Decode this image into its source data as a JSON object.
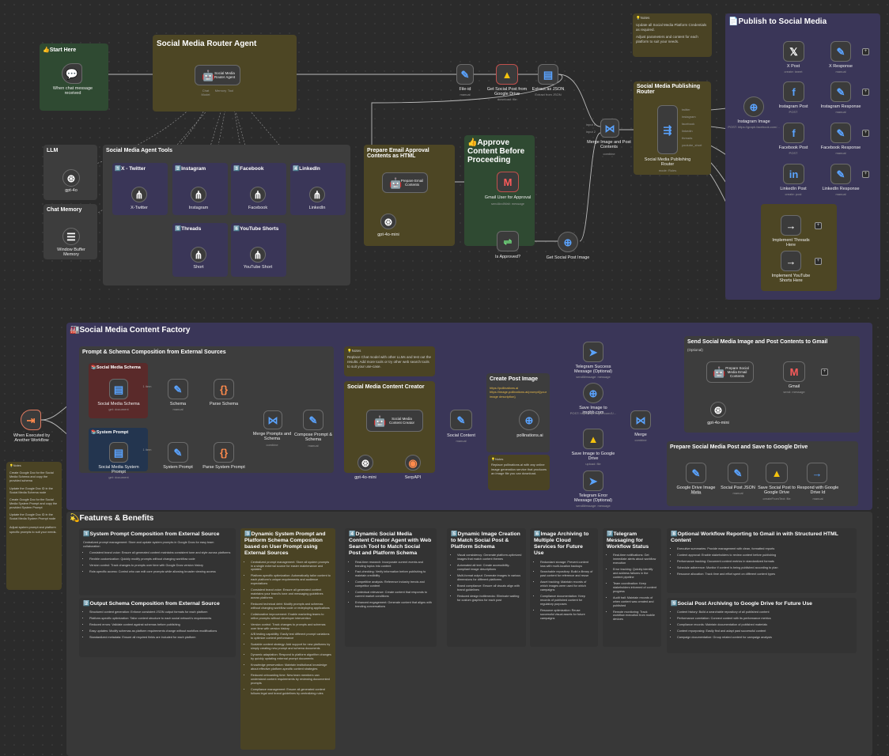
{
  "top": {
    "start_title": "👍Start Here",
    "router_title": "Social Media Router Agent",
    "router_node": {
      "label": "Social Media Router Agent",
      "sub": "Tools Agent"
    },
    "trigger_node": {
      "label": "When chat message received"
    },
    "port_labels": [
      "Chat Model",
      "Memory",
      "Tool"
    ],
    "llm_title": "LLM",
    "llm_node": "gpt-4o",
    "memory_title": "Chat Memory",
    "memory_node": "Window Buffer Memory",
    "tools_title": "Social Media Agent Tools",
    "tools": [
      {
        "title": "1️⃣X - Twitter",
        "node": "X-Twitter"
      },
      {
        "title": "2️⃣Instagram",
        "node": "Instagram"
      },
      {
        "title": "3️⃣Facebook",
        "node": "Facebook"
      },
      {
        "title": "4️⃣LinkedIn",
        "node": "LinkedIn"
      },
      {
        "title": "5️⃣Threads",
        "node": "Short"
      },
      {
        "title": "6️⃣YouTube Shorts",
        "node": "YouTube Short"
      }
    ],
    "file_id": {
      "label": "File-id",
      "sub": "manual"
    },
    "gdrive_get": {
      "label": "Get Social Post from Google Drive",
      "sub": "download: file"
    },
    "extract_json": {
      "label": "Extract as JSON",
      "sub": "Extract from JSON"
    },
    "email_title": "Prepare Email Approval Contents as HTML",
    "email_node": {
      "label": "Prepare Email Contents",
      "sub": "Tools Agent"
    },
    "email_model": "gpt-4o-mini",
    "approve_title": "👍Approve Content Before Proceeding",
    "gmail_node": {
      "label": "Gmail User for Approval",
      "sub": "sendAndWait: message"
    },
    "is_approved": "Is Approved?",
    "get_image": "Get Social Post Image",
    "merge_node": {
      "label": "Merge Image and Post Contents",
      "sub": "combine"
    },
    "merge_ports": [
      "input 1",
      "input 2"
    ],
    "notes_text": [
      "💡Notes",
      "Update all Social Media Platform Credentials as required.",
      "Adjust parameters and content for each platform to suit your needs."
    ],
    "pub_router_title": "Social Media Publishing Router",
    "pub_router_node": {
      "label": "Social Media Publishing Router",
      "sub": "mode: Rules"
    },
    "router_outputs": [
      "twitter",
      "instagram",
      "facebook",
      "linkedin",
      "threads",
      "youtube_short"
    ],
    "publish_title": "📄Publish to Social Media",
    "publish_nodes": [
      {
        "label": "X Post",
        "sub": "create: tweet"
      },
      {
        "label": "X Response",
        "sub": "manual"
      },
      {
        "label": "Instagram Image",
        "sub": "POST: https://graph.facebook.com/..."
      },
      {
        "label": "Instagram Post",
        "sub": "POST"
      },
      {
        "label": "Instagram Response",
        "sub": "manual"
      },
      {
        "label": "Facebook Post",
        "sub": "POST"
      },
      {
        "label": "Facebook Response",
        "sub": "manual"
      },
      {
        "label": "LinkedIn Post",
        "sub": "create: post"
      },
      {
        "label": "LinkedIn Response",
        "sub": "manual"
      },
      {
        "label": "Implement Threads Here",
        "sub": ""
      },
      {
        "label": "Implement YouTube Shorts Here",
        "sub": ""
      }
    ]
  },
  "factory": {
    "title": "🏭Social Media Content Factory",
    "prompt_group_title": "Prompt & Schema Composition from External Sources",
    "schema_group": "📚Social Media Schema",
    "schema_node": {
      "label": "Social Media Schema",
      "sub": "get: document"
    },
    "schema_set": {
      "label": "Schema",
      "sub": "manual"
    },
    "parse_schema": {
      "label": "Parse Schema",
      "sub": ""
    },
    "sysprompt_group": "📚System Prompt",
    "sysprompt_node": {
      "label": "Social Media System Prompt",
      "sub": "get: document"
    },
    "sysprompt_set": {
      "label": "System Prompt",
      "sub": "manual"
    },
    "parse_sysprompt": {
      "label": "Parse System Prompt",
      "sub": ""
    },
    "item_label": "1 item",
    "workflow_trigger": {
      "label": "When Executed by Another Workflow"
    },
    "merge_prompts": {
      "label": "Merge Prompts and Schema",
      "sub": "combine"
    },
    "compose": {
      "label": "Compose Prompt & Schema",
      "sub": "manual"
    },
    "notes2": [
      "💡Notes",
      "Replace Chat model with other LLMs and test out the results. Add more tools or try other web search tools to suit your use-case."
    ],
    "creator_title": "Social Media Content Creator",
    "creator_node": {
      "label": "Social Media Content Creator",
      "sub": "Tools Agent"
    },
    "creator_model": "gpt-4o-mini",
    "creator_tool": "SerpAPI",
    "creator_ports": [
      "Chat Model",
      "Memory",
      "Tool",
      "Output Parser"
    ],
    "social_content": {
      "label": "Social Content",
      "sub": "manual"
    },
    "create_image_title": "Create Post Image",
    "create_image_text": "https://pollinations.ai https://image.pollinations.ai/prompt/{your image description}",
    "pollinations": {
      "label": "pollinations.ai",
      "sub": ""
    },
    "notes3": [
      "💡Notes",
      "Replace pollinations.ai with any online image generation service that produces an image file you can download."
    ],
    "telegram_ok": {
      "label": "Telegram Success Message (Optional)",
      "sub": "sendMessage: message"
    },
    "save_imgbb": {
      "label": "Save Image to imgbb.com",
      "sub": "POST: https://api.imgbb.com/1/..."
    },
    "save_gdrive_img": {
      "label": "Save Image to Google Drive",
      "sub": "upload: file"
    },
    "telegram_err": {
      "label": "Telegram Error Message (Optional)",
      "sub": "sendMessage: message"
    },
    "merge2": {
      "label": "Merge",
      "sub": "combine"
    },
    "send_gmail_title": "Send Social Media Image and Post Contents to Gmail",
    "optional": "(Optional)",
    "prep_gmail_node": {
      "label": "Prepare Social Media Email Contents",
      "sub": "Tools Agent"
    },
    "gmail_send": {
      "label": "Gmail",
      "sub": "send: message"
    },
    "gmail_model": "gpt-4o-mini",
    "save_drive_title": "Prepare Social Media Post and Save to Google Drive",
    "drive_nodes": [
      {
        "label": "Google Drive Image Meta",
        "sub": "manual"
      },
      {
        "label": "Social Post JSON",
        "sub": "manual"
      },
      {
        "label": "Save Social Post to Google Drive",
        "sub": "createFromText: file"
      },
      {
        "label": "Respond with Google Drive Id",
        "sub": "manual"
      }
    ],
    "left_notes": [
      "💡Notes",
      "Create Google Doc for the Social Media Schema and copy the provided schema",
      "Update the Google Doc ID in the Social Media Schema node",
      "Create Google Doc for the Social Media System Prompt and copy the provided System Prompt",
      "Update the Google Doc ID in the Social Media System Prompt node",
      "Adjust system prompt and platform specific prompts to suit your needs."
    ]
  },
  "features": {
    "title": "💫Features & Benefits",
    "cards": [
      {
        "title": "1️⃣System Prompt Composition from External Source",
        "intro": "Centralized prompt management: Store and update system prompts in Google Docs for easy team collaboration",
        "items": [
          "Consistent brand voice: Ensure all generated content maintains consistent tone and style across platforms",
          "Flexible customization: Quickly modify prompts without changing workflow code",
          "Version control: Track changes to prompts over time with Google Docs version history",
          "Role-specific access: Control who can edit core prompts while allowing broader viewing access"
        ]
      },
      {
        "title": "2️⃣Output Schema Composition from External Source",
        "intro": "",
        "items": [
          "Structured content generation: Enforce consistent JSON output formats for each platform",
          "Platform-specific optimization: Tailor content structure to each social network's requirements",
          "Reduced errors: Validate content against schemas before publishing",
          "Easy updates: Modify schemas as platform requirements change without workflow modifications",
          "Standardized metadata: Ensure all required fields are included for each platform"
        ]
      },
      {
        "title": "3️⃣Dynamic System Prompt and Platform Schema Composition based on User Prompt using External Sources",
        "intro": "",
        "items": [
          "Centralized prompt management: Store all system prompts in a single external source for easier maintenance and updates",
          "Platform-specific optimization: Automatically tailor content to each platform's unique requirements and audience expectations",
          "Consistent brand voice: Ensure all generated content maintains your brand's tone and messaging guidelines across platforms",
          "Reduced technical debt: Modify prompts and schemas without changing workflow code or redeploying applications",
          "Collaborative improvement: Enable marketing teams to refine prompts without developer intervention",
          "Version control: Track changes to prompts and schemas over time with version history",
          "A/B testing capability: Easily test different prompt variations to optimize content performance",
          "Scalable content strategy: Add support for new platforms by simply creating new prompt and schema documents",
          "Dynamic adaptation: Respond to platform algorithm changes by quickly updating external prompt documents",
          "Knowledge preservation: Maintain institutional knowledge about effective platform-specific content strategies",
          "Reduced onboarding time: New team members can understand content requirements by reviewing documented prompts",
          "Compliance management: Ensure all generated content follows legal and brand guidelines by centralizing rules"
        ]
      },
      {
        "title": "4️⃣Dynamic Social Media Content Creator Agent with Web Search Tool to Match Social Post and Platform Schema",
        "intro": "",
        "items": [
          "Real-time research: Incorporate current events and trending topics into content",
          "Fact-checking: Verify information before publishing to maintain credibility",
          "Competitive analysis: Reference industry trends and competitor content",
          "Contextual relevance: Create content that responds to current market conditions",
          "Enhanced engagement: Generate content that aligns with trending conversations"
        ]
      },
      {
        "title": "5️⃣Dynamic Image Creation to Match Social Post & Platform Schema",
        "intro": "",
        "items": [
          "Visual consistency: Generate platform-optimized images that match content themes",
          "Automated alt text: Create accessibility-compliant image descriptions",
          "Multi-format output: Generate images in various dimensions for different platforms",
          "Brand compliance: Ensure all visuals align with brand guidelines",
          "Reduced design bottlenecks: Eliminate waiting for custom graphics for each post"
        ]
      },
      {
        "title": "6️⃣Image Archiving to Multiple Cloud Services for Future Use",
        "intro": "",
        "items": [
          "Redundant storage: Prevent content loss with multi-location backups",
          "Searchable repository: Build a library of past content for reference and reuse",
          "Asset tracking: Maintain records of which images were used for which campaigns",
          "Compliance documentation: Keep records of published content for regulatory purposes",
          "Resource optimization: Reuse successful visual assets for future campaigns"
        ]
      },
      {
        "title": "7️⃣Telegram Messaging for Workflow Status",
        "intro": "",
        "items": [
          "Real-time notifications: Get immediate alerts about workflow execution",
          "Error tracking: Quickly identify and address failures in the content pipeline",
          "Team coordination: Keep stakeholders informed of content progress",
          "Audit trail: Maintain records of when content was created and published",
          "Remote monitoring: Track workflow execution from mobile devices"
        ]
      },
      {
        "title": "8️⃣Optional Workflow Reporting to Gmail in with Structured HTML Content",
        "intro": "",
        "items": [
          "Executive summaries: Provide management with clean, formatted reports",
          "Content approval: Enable stakeholders to review content before publishing",
          "Performance tracking: Document content metrics in standardized formats",
          "Schedule adherence: Monitor if content is being published according to plan",
          "Resource allocation: Track time and effort spent on different content types"
        ]
      },
      {
        "title": "9️⃣Social Post Archiving to Google Drive for Future Use",
        "intro": "",
        "items": [
          "Content history: Build a searchable repository of all published content",
          "Performance correlation: Connect content with its performance metrics",
          "Compliance records: Maintain documentation of published materials",
          "Content repurposing: Easily find and adapt past successful content",
          "Campaign documentation: Group related content for campaign analysis"
        ]
      }
    ]
  }
}
